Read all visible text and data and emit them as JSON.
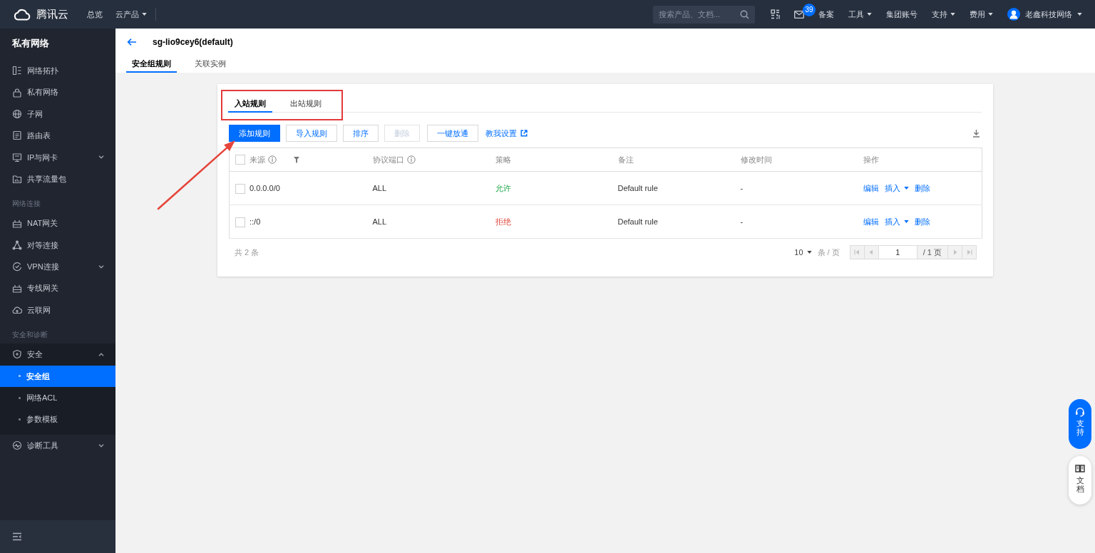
{
  "topbar": {
    "brand": "腾讯云",
    "nav": [
      {
        "label": "总览",
        "dropdown": false
      },
      {
        "label": "云产品",
        "dropdown": true
      }
    ],
    "search": {
      "placeholder": "搜索产品、文档..."
    },
    "mail_badge": "39",
    "menu": [
      {
        "label": "备案",
        "dropdown": false
      },
      {
        "label": "工具",
        "dropdown": true
      },
      {
        "label": "集团账号",
        "dropdown": false
      },
      {
        "label": "支持",
        "dropdown": true
      },
      {
        "label": "费用",
        "dropdown": true
      }
    ],
    "account": {
      "label": "老鑫科技网络",
      "dropdown": true
    }
  },
  "sidebar": {
    "title": "私有网络",
    "items": [
      {
        "kind": "item",
        "label": "网络拓扑",
        "selected": false
      },
      {
        "kind": "item",
        "label": "私有网络",
        "selected": false
      },
      {
        "kind": "item",
        "label": "子网",
        "selected": false
      },
      {
        "kind": "item",
        "label": "路由表",
        "selected": false
      },
      {
        "kind": "item",
        "label": "IP与网卡",
        "selected": false,
        "expanded": false
      },
      {
        "kind": "item",
        "label": "共享流量包",
        "selected": false
      },
      {
        "kind": "section",
        "label": "网络连接"
      },
      {
        "kind": "item",
        "label": "NAT网关",
        "selected": false
      },
      {
        "kind": "item",
        "label": "对等连接",
        "selected": false
      },
      {
        "kind": "item",
        "label": "VPN连接",
        "selected": false,
        "expanded": false
      },
      {
        "kind": "item",
        "label": "专线网关",
        "selected": false
      },
      {
        "kind": "item",
        "label": "云联网",
        "selected": false
      },
      {
        "kind": "section",
        "label": "安全和诊断"
      },
      {
        "kind": "item",
        "label": "安全",
        "selected": false,
        "expanded": true,
        "children": [
          {
            "label": "安全组",
            "selected": true
          },
          {
            "label": "网络ACL",
            "selected": false
          },
          {
            "label": "参数模板",
            "selected": false
          }
        ]
      },
      {
        "kind": "item",
        "label": "诊断工具",
        "selected": false,
        "expanded": false
      }
    ]
  },
  "page": {
    "title": "sg-lio9cey6(default)",
    "tabs": [
      {
        "label": "安全组规则",
        "selected": true
      },
      {
        "label": "关联实例",
        "selected": false
      }
    ]
  },
  "rules": {
    "tabs": [
      {
        "label": "入站规则",
        "selected": true
      },
      {
        "label": "出站规则",
        "selected": false
      }
    ],
    "toolbar": {
      "buttons": [
        {
          "label": "添加规则",
          "kind": "primary",
          "disabled": false
        },
        {
          "label": "导入规则",
          "kind": "default",
          "disabled": false
        },
        {
          "label": "排序",
          "kind": "default",
          "disabled": false
        },
        {
          "label": "删除",
          "kind": "default",
          "disabled": true
        },
        {
          "label": "一键放通",
          "kind": "default",
          "disabled": false
        }
      ],
      "help_link": "教我设置"
    },
    "table": {
      "header_checked": false,
      "columns": [
        {
          "label": "来源",
          "info": true,
          "filter": true
        },
        {
          "label": "协议端口",
          "info": true,
          "filter": false
        },
        {
          "label": "策略",
          "info": false,
          "filter": false
        },
        {
          "label": "备注",
          "info": false,
          "filter": false
        },
        {
          "label": "修改时间",
          "info": false,
          "filter": false
        },
        {
          "label": "操作",
          "info": false,
          "filter": false
        }
      ],
      "rows": [
        {
          "checked": false,
          "source": "0.0.0.0/0",
          "protocol_port": "ALL",
          "policy": {
            "label": "允许",
            "kind": "allow"
          },
          "note": "Default rule",
          "modified": "-",
          "actions": [
            {
              "label": "编辑",
              "dropdown": false
            },
            {
              "label": "插入",
              "dropdown": true
            },
            {
              "label": "删除",
              "dropdown": false
            }
          ]
        },
        {
          "checked": false,
          "source": "::/0",
          "protocol_port": "ALL",
          "policy": {
            "label": "拒绝",
            "kind": "deny"
          },
          "note": "Default rule",
          "modified": "-",
          "actions": [
            {
              "label": "编辑",
              "dropdown": false
            },
            {
              "label": "插入",
              "dropdown": true
            },
            {
              "label": "删除",
              "dropdown": false
            }
          ]
        }
      ]
    },
    "footer": {
      "total": "共 2 条",
      "page_size": "10",
      "page_size_unit": "条 / 页",
      "page": "1",
      "page_count": "/ 1 页",
      "back_disabled": true,
      "forward_disabled": true
    }
  },
  "float_buttons": [
    {
      "label": "支持",
      "kind": "primary"
    },
    {
      "label": "文档",
      "kind": "plain"
    }
  ],
  "annotation": {
    "highlight_frame": true,
    "pointer_arrow": true
  }
}
